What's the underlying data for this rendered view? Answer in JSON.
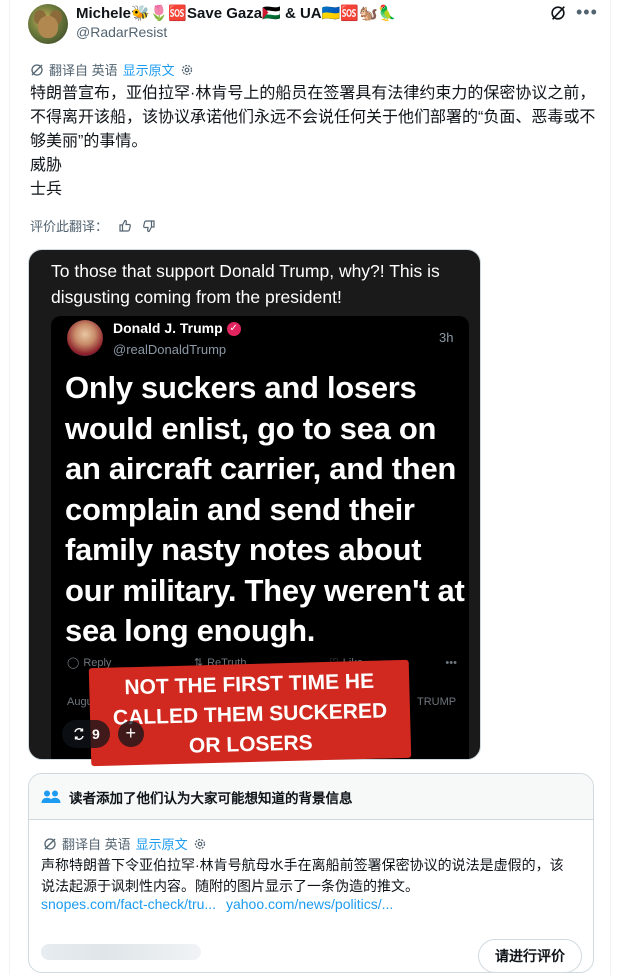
{
  "author": {
    "display_name": "Michele🐝🌷🆘Save Gaza🇵🇸 & UA🇺🇦🆘🐿️🦜",
    "handle": "@RadarResist"
  },
  "translate_bar": {
    "from_label": "翻译自 英语",
    "show_original": "显示原文"
  },
  "tweet": {
    "lines": [
      "特朗普宣布，亚伯拉罕·林肯号上的船员在签署具有法律约束力的保密协议之前，不得离开该船，该协议承诺他们永远不会说任何关于他们部署的“负面、恶毒或不够美丽”的事情。",
      "威胁",
      "士兵"
    ]
  },
  "rate_translation": {
    "label": "评价此翻译："
  },
  "media": {
    "caption": "To those that support Donald Trump, why?! This is disgusting coming from the president!",
    "inner_name": "Donald J. Trump",
    "inner_handle": "@realDonaldTrump",
    "inner_time": "3h",
    "quote": "Only suckers and losers would enlist, go to sea on an aircraft carrier, and then complain and send their family nasty notes about our military. They weren't at sea long enough.",
    "actions": {
      "reply": "Reply",
      "retruth": "ReTruth",
      "like": "Like"
    },
    "bottom_left": "Augus",
    "bottom_right": "TRUMP",
    "banner": "NOT THE FIRST TIME HE CALLED THEM SUCKERED OR LOSERS",
    "reposts_count": "9"
  },
  "community_note": {
    "title": "读者添加了他们认为大家可能想知道的背景信息",
    "translate_from": "翻译自 英语",
    "show_original": "显示原文",
    "body": "声称特朗普下令亚伯拉罕·林肯号航母水手在离船前签署保密协议的说法是虚假的，该说法起源于讽刺性内容。随附的图片显示了一条伪造的推文。",
    "link1": "snopes.com/fact-check/tru...",
    "link2": "yahoo.com/news/politics/...",
    "rate_button": "请进行评价"
  },
  "colors": {
    "link": "#1d9bf0",
    "muted": "#536471",
    "banner_red": "#d1291f"
  }
}
